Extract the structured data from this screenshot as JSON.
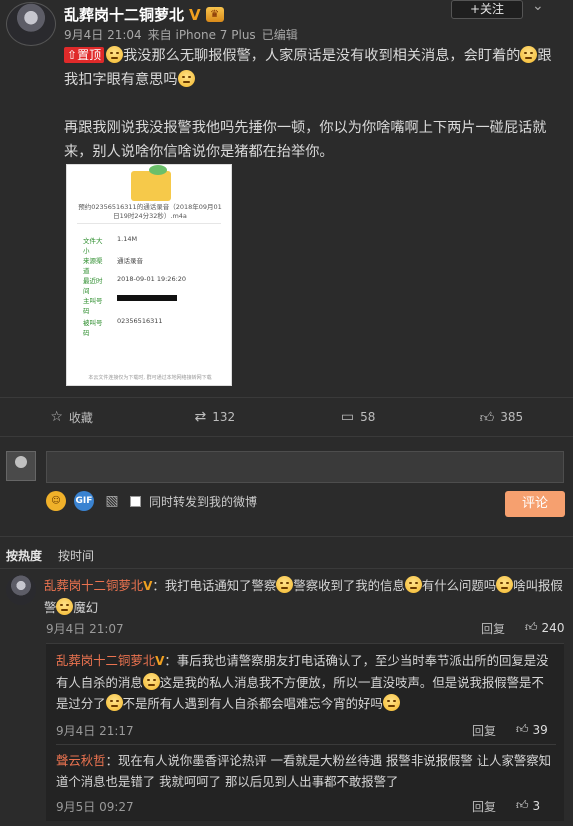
{
  "post": {
    "author": "乱葬岗十二铜萝北",
    "verified": "V",
    "date": "9月4日 21:04",
    "source": "来自 iPhone 7 Plus",
    "edited": "已编辑",
    "follow_label": "+关注",
    "menu": "⌄",
    "pinned_label": "置顶",
    "text_p1a": "我没那么无聊报假警，人家原话是没有收到相关消息，会盯着的",
    "text_p1b": "跟我扣字眼有意思吗",
    "text_p2": "再跟我刚说我没报警我他吗先捶你一顿，你以为你啥嘴啊上下两片一碰屁话就来，别人说啥你信啥说你是猪都在抬举你。"
  },
  "attachment": {
    "title": "预约02356516311的通话录音（2018年09月01日19时24分32秒）.m4a",
    "rows": [
      {
        "k": "文件大小",
        "v": "1.14M"
      },
      {
        "k": "来源渠道",
        "v": "通话录音"
      },
      {
        "k": "最近时间",
        "v": "2018-09-01 19:26:20"
      },
      {
        "k": "主叫号码",
        "v": ""
      },
      {
        "k": "被叫号码",
        "v": "02356516311"
      }
    ],
    "footer": "本云文件连接仅为下载时, 群可通过本地网络接转网下载"
  },
  "actions": {
    "favorite": "收藏",
    "repost": "132",
    "comment": "58",
    "like": "385"
  },
  "composer": {
    "input_value": "",
    "gif": "GIF",
    "repost_label": "同时转发到我的微博",
    "submit_label": "评论"
  },
  "sort": {
    "by_hot": "按热度",
    "by_time": "按时间"
  },
  "comments": [
    {
      "name": "乱葬岗十二铜萝北",
      "text_a": "：我打电话通知了警察",
      "text_b": "警察收到了我的信息",
      "text_c": "有什么问题吗",
      "text_d": "啥叫报假警",
      "text_e": "魔幻",
      "time": "9月4日 21:07",
      "reply": "回复",
      "likes": "240"
    }
  ],
  "replies": [
    {
      "name": "乱葬岗十二铜萝北",
      "text_a": "：事后我也请警察朋友打电话确认了，至少当时奉节派出所的回复是没有人自杀的消息",
      "text_b": "这是我的私人消息我不方便放，所以一直没吱声。但是说我报假警是不是过分了",
      "text_c": "不是所有人遇到有人自杀都会唱难忘今宵的好吗",
      "time": "9月4日 21:17",
      "reply": "回复",
      "likes": "39"
    },
    {
      "name": "聲云秋哲",
      "text_a": "：现在有人说你墨香评论热评 一看就是大粉丝待遇 报警非说报假警 让人家警察知道个消息也是错了 我就呵呵了 那以后见到人出事都不敢报警了",
      "time": "9月5日 09:27",
      "reply": "回复",
      "likes": "3"
    }
  ],
  "icons": {
    "favorite": "star-icon",
    "repost": "repost-icon",
    "comment": "comment-icon",
    "like": "thumbs-up-icon",
    "image": "image-icon",
    "emoji": "smile-emoji-icon"
  },
  "colors": {
    "background": "#2b2b2b",
    "name_link": "#eb7350",
    "pin_red": "#e02a2a",
    "submit_orange": "#f6a06f",
    "verified_gold": "#f0a020"
  }
}
